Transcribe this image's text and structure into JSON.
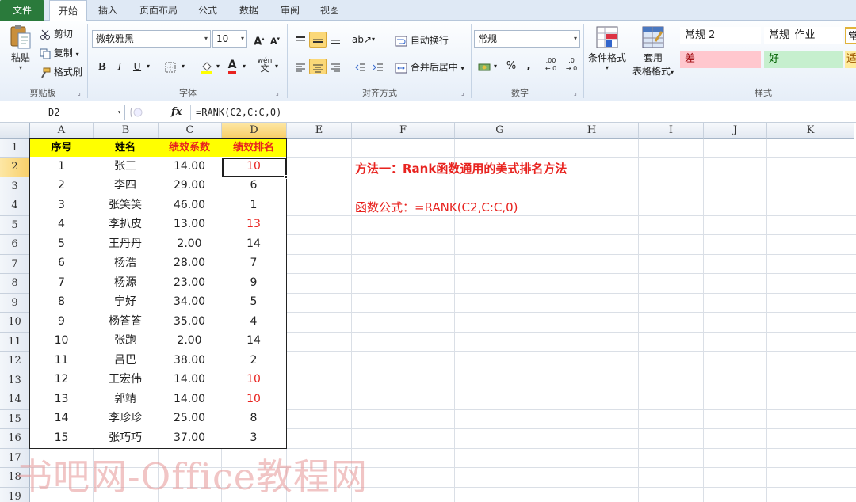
{
  "tabs": [
    {
      "label": "文件"
    },
    {
      "label": "开始"
    },
    {
      "label": "插入"
    },
    {
      "label": "页面布局"
    },
    {
      "label": "公式"
    },
    {
      "label": "数据"
    },
    {
      "label": "审阅"
    },
    {
      "label": "视图"
    }
  ],
  "ribbon": {
    "clipboard": {
      "paste": "粘贴",
      "cut": "剪切",
      "copy": "复制",
      "format_painter": "格式刷",
      "label": "剪贴板"
    },
    "font": {
      "name": "微软雅黑",
      "size": "10",
      "grow": "A",
      "shrink": "A",
      "bold": "B",
      "italic": "I",
      "underline": "U",
      "font_color_letter": "A",
      "phonetic": "wén",
      "label": "字体"
    },
    "alignment": {
      "wrap_text": "自动换行",
      "merge_center": "合并后居中",
      "label": "对齐方式"
    },
    "number": {
      "format": "常规",
      "percent": "%",
      "comma": ",",
      "inc_decimal": ".00",
      "dec_decimal": ".0",
      "label": "数字"
    },
    "styles": {
      "conditional_format": "条件格式",
      "format_as_table_1": "套用",
      "format_as_table_2": "表格格式",
      "cells": [
        {
          "label": "常规 2"
        },
        {
          "label": "常规_作业"
        },
        {
          "label": "常"
        },
        {
          "label": "差"
        },
        {
          "label": "好"
        },
        {
          "label": "适"
        }
      ],
      "label": "样式"
    }
  },
  "formula_bar": {
    "name_box": "D2",
    "fx": "fx",
    "formula": "=RANK(C2,C:C,0)"
  },
  "sheet": {
    "columns": [
      "A",
      "B",
      "C",
      "D",
      "E",
      "F",
      "G",
      "H",
      "I",
      "J",
      "K"
    ],
    "rows": [
      "1",
      "2",
      "3",
      "4",
      "5",
      "6",
      "7",
      "8",
      "9",
      "10",
      "11",
      "12",
      "13",
      "14",
      "15",
      "16",
      "17",
      "18",
      "19"
    ],
    "selected_cell": "D2",
    "table_headers": [
      "序号",
      "姓名",
      "绩效系数",
      "绩效排名"
    ],
    "table_rows": [
      {
        "no": "1",
        "name": "张三",
        "coef": "14.00",
        "rank": "10",
        "red": true
      },
      {
        "no": "2",
        "name": "李四",
        "coef": "29.00",
        "rank": "6",
        "red": false
      },
      {
        "no": "3",
        "name": "张笑笑",
        "coef": "46.00",
        "rank": "1",
        "red": false
      },
      {
        "no": "4",
        "name": "李扒皮",
        "coef": "13.00",
        "rank": "13",
        "red": true
      },
      {
        "no": "5",
        "name": "王丹丹",
        "coef": "2.00",
        "rank": "14",
        "red": false
      },
      {
        "no": "6",
        "name": "杨浩",
        "coef": "28.00",
        "rank": "7",
        "red": false
      },
      {
        "no": "7",
        "name": "杨源",
        "coef": "23.00",
        "rank": "9",
        "red": false
      },
      {
        "no": "8",
        "name": "宁好",
        "coef": "34.00",
        "rank": "5",
        "red": false
      },
      {
        "no": "9",
        "name": "杨答答",
        "coef": "35.00",
        "rank": "4",
        "red": false
      },
      {
        "no": "10",
        "name": "张跑",
        "coef": "2.00",
        "rank": "14",
        "red": false
      },
      {
        "no": "11",
        "name": "吕巴",
        "coef": "38.00",
        "rank": "2",
        "red": false
      },
      {
        "no": "12",
        "name": "王宏伟",
        "coef": "14.00",
        "rank": "10",
        "red": true
      },
      {
        "no": "13",
        "name": "郭靖",
        "coef": "14.00",
        "rank": "10",
        "red": true
      },
      {
        "no": "14",
        "name": "李珍珍",
        "coef": "25.00",
        "rank": "8",
        "red": false
      },
      {
        "no": "15",
        "name": "张巧巧",
        "coef": "37.00",
        "rank": "3",
        "red": false
      }
    ],
    "note_title": "方法一：Rank函数通用的美式排名方法",
    "note_formula": "函数公式：=RANK(C2,C:C,0)"
  },
  "watermark": "书吧网-Office教程网",
  "colors": {
    "header_fill": "#ffff00",
    "header_red_text": "#e8231f",
    "file_tab": "#2a7a3b",
    "selection_header": "#f8cf6a"
  }
}
